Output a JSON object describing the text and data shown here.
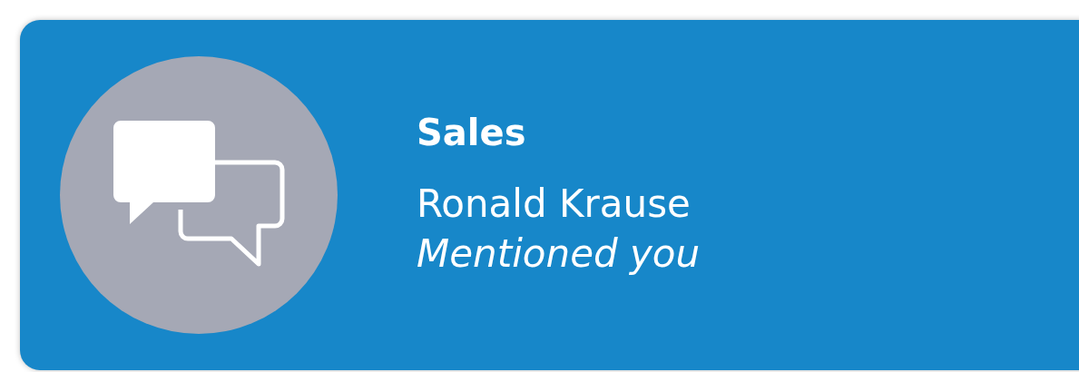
{
  "notification": {
    "channel": "Sales",
    "sender": "Ronald Krause",
    "message": "Mentioned you"
  }
}
